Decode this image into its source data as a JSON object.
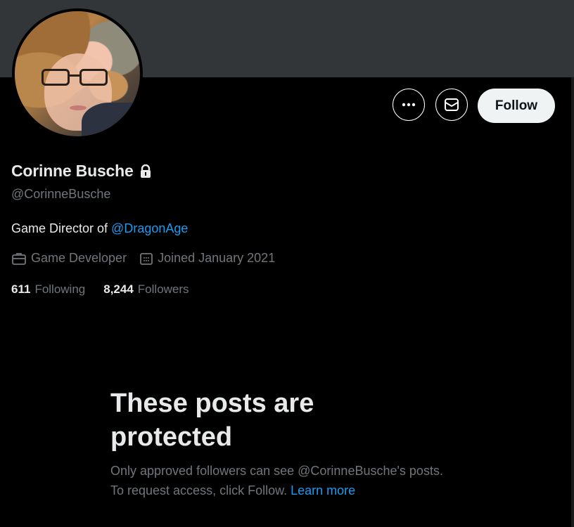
{
  "profile": {
    "name": "Corinne Busche",
    "handle": "@CorinneBusche",
    "bio_prefix": "Game Director of ",
    "bio_mention": "@DragonAge",
    "profession": "Game Developer",
    "joined": "Joined January 2021",
    "following_count": "611",
    "following_label": "Following",
    "followers_count": "8,244",
    "followers_label": "Followers"
  },
  "actions": {
    "more_icon": "more-horizontal-icon",
    "message_icon": "mail-icon",
    "follow_label": "Follow"
  },
  "protected": {
    "title": "These posts are protected",
    "description": "Only approved followers can see @CorinneBusche's posts. To request access, click Follow.",
    "learn_more": "Learn more"
  },
  "colors": {
    "background": "#000000",
    "banner": "#333639",
    "text_primary": "#e7e9ea",
    "text_secondary": "#71767b",
    "accent": "#1d9bf0",
    "follow_button": "#eff3f4"
  }
}
